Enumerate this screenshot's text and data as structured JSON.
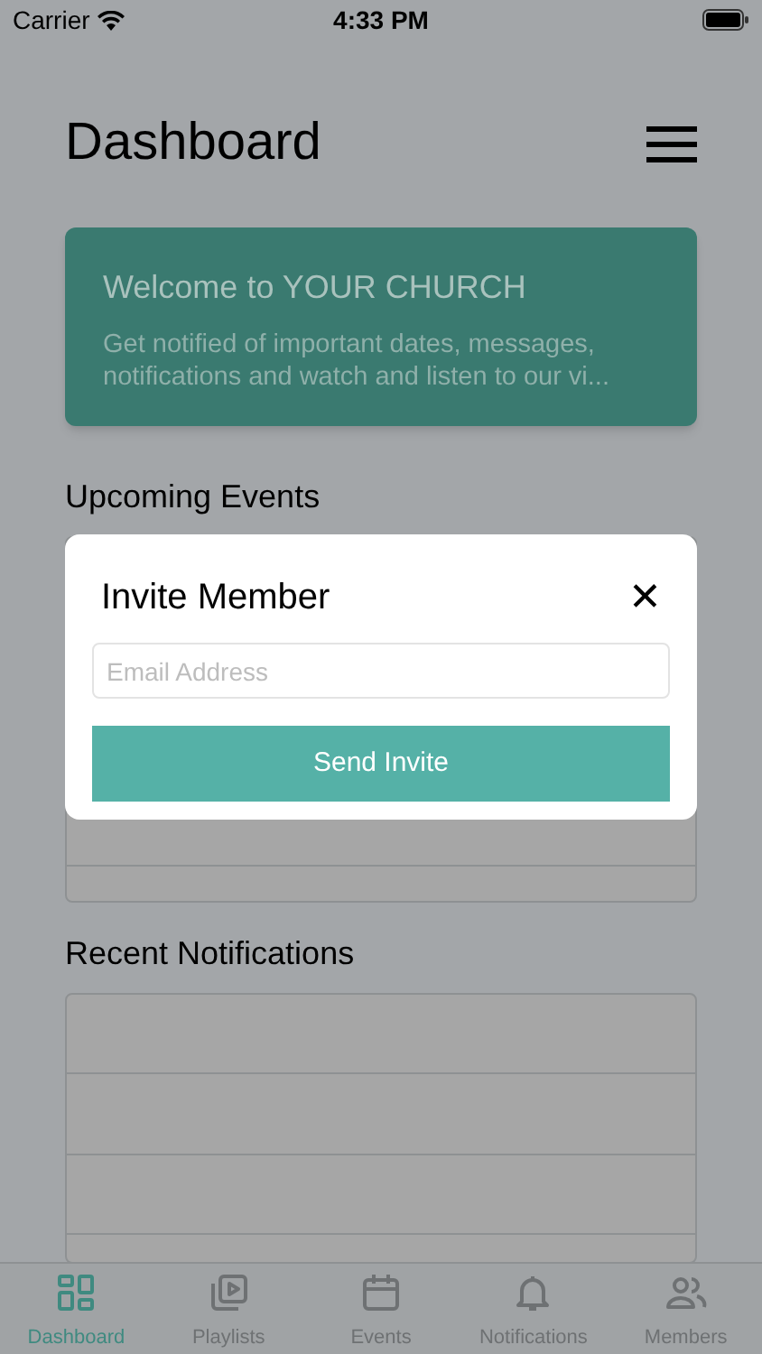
{
  "status_bar": {
    "carrier": "Carrier",
    "time": "4:33 PM"
  },
  "header": {
    "title": "Dashboard"
  },
  "welcome_card": {
    "title": "Welcome to YOUR CHURCH",
    "text": "Get notified of important dates, messages, notifications and watch and listen to our vi..."
  },
  "sections": [
    {
      "title": "Upcoming Events"
    },
    {
      "title": "Recent Notifications"
    }
  ],
  "modal": {
    "title": "Invite Member",
    "close": "✕",
    "email_field": {
      "placeholder": "Email Address"
    },
    "button": "Send Invite"
  },
  "tab_bar": [
    {
      "label": "Dashboard",
      "selected": true
    },
    {
      "label": "Playlists",
      "selected": false
    },
    {
      "label": "Events",
      "selected": false
    },
    {
      "label": "Notifications",
      "selected": false
    },
    {
      "label": "Members",
      "selected": false
    }
  ]
}
